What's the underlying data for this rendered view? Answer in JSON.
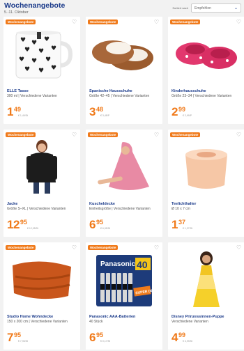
{
  "page": {
    "title": "Wochenangebote",
    "subtitle": "5.-11. Oktober",
    "sort_label": "Sortiert nach",
    "sort_value": "Empfohlen"
  },
  "colors": {
    "brand_orange": "#f07a1a",
    "brand_blue": "#1a3a8a"
  },
  "products": [
    {
      "badge": "Wochenangebote",
      "name": "ELLE Tasse",
      "desc": "300 ml | Verschiedene Varianten",
      "price_int": "1",
      "price_dec": "49",
      "unit": "€ 1,49/St",
      "icon": "heart-mug"
    },
    {
      "badge": "Wochenangebote",
      "name": "Spanische Hausschuhe",
      "desc": "Größe 42–45 | Verschiedene Varianten",
      "price_int": "3",
      "price_dec": "48",
      "unit": "€ 3,48/P",
      "icon": "slippers-brown"
    },
    {
      "badge": "Wochenangebote",
      "name": "Kinderhausschuhe",
      "desc": "Größe 23–34 | Verschiedene Varianten",
      "price_int": "2",
      "price_dec": "99",
      "unit": "€ 2,99/P",
      "icon": "slippers-pink"
    },
    {
      "badge": "Wochenangebote",
      "name": "Jacke",
      "desc": "Größe S–XL | Verschiedene Varianten",
      "price_int": "12",
      "price_dec": "95",
      "unit": "€ 12,95/St",
      "icon": "jacket"
    },
    {
      "badge": "Wochenangebote",
      "name": "Kuscheldecke",
      "desc": "Einheitsgröße | Verschiedene Varianten",
      "price_int": "6",
      "price_dec": "95",
      "unit": "€ 6,95/St",
      "icon": "hooded-blanket"
    },
    {
      "badge": "Wochenangebote",
      "name": "Teelichthalter",
      "desc": "Ø 10 x 7 cm",
      "price_int": "1",
      "price_dec": "37",
      "unit": "€ 1,37/St",
      "icon": "salt-candle"
    },
    {
      "badge": "Wochenangebote",
      "name": "Studio Home Wohndecke",
      "desc": "150 x 200 cm | Verschiedene Varianten",
      "price_int": "7",
      "price_dec": "95",
      "unit": "€ 7,95/St",
      "icon": "orange-blanket"
    },
    {
      "badge": "Wochenangebote",
      "name": "Panasonic AAA-Batterien",
      "desc": "40 Stück",
      "price_int": "6",
      "price_dec": "95",
      "unit": "€ 0,17/St",
      "icon": "batteries"
    },
    {
      "badge": "",
      "name": "Disney Prinzessinnen-Puppe",
      "desc": "Verschiedene Varianten",
      "price_int": "4",
      "price_dec": "99",
      "unit": "€ 4,99/St",
      "icon": "princess-doll"
    }
  ],
  "battery_pack": {
    "brand": "Panasonic",
    "count": "40",
    "label": "SUPER DEAL"
  }
}
